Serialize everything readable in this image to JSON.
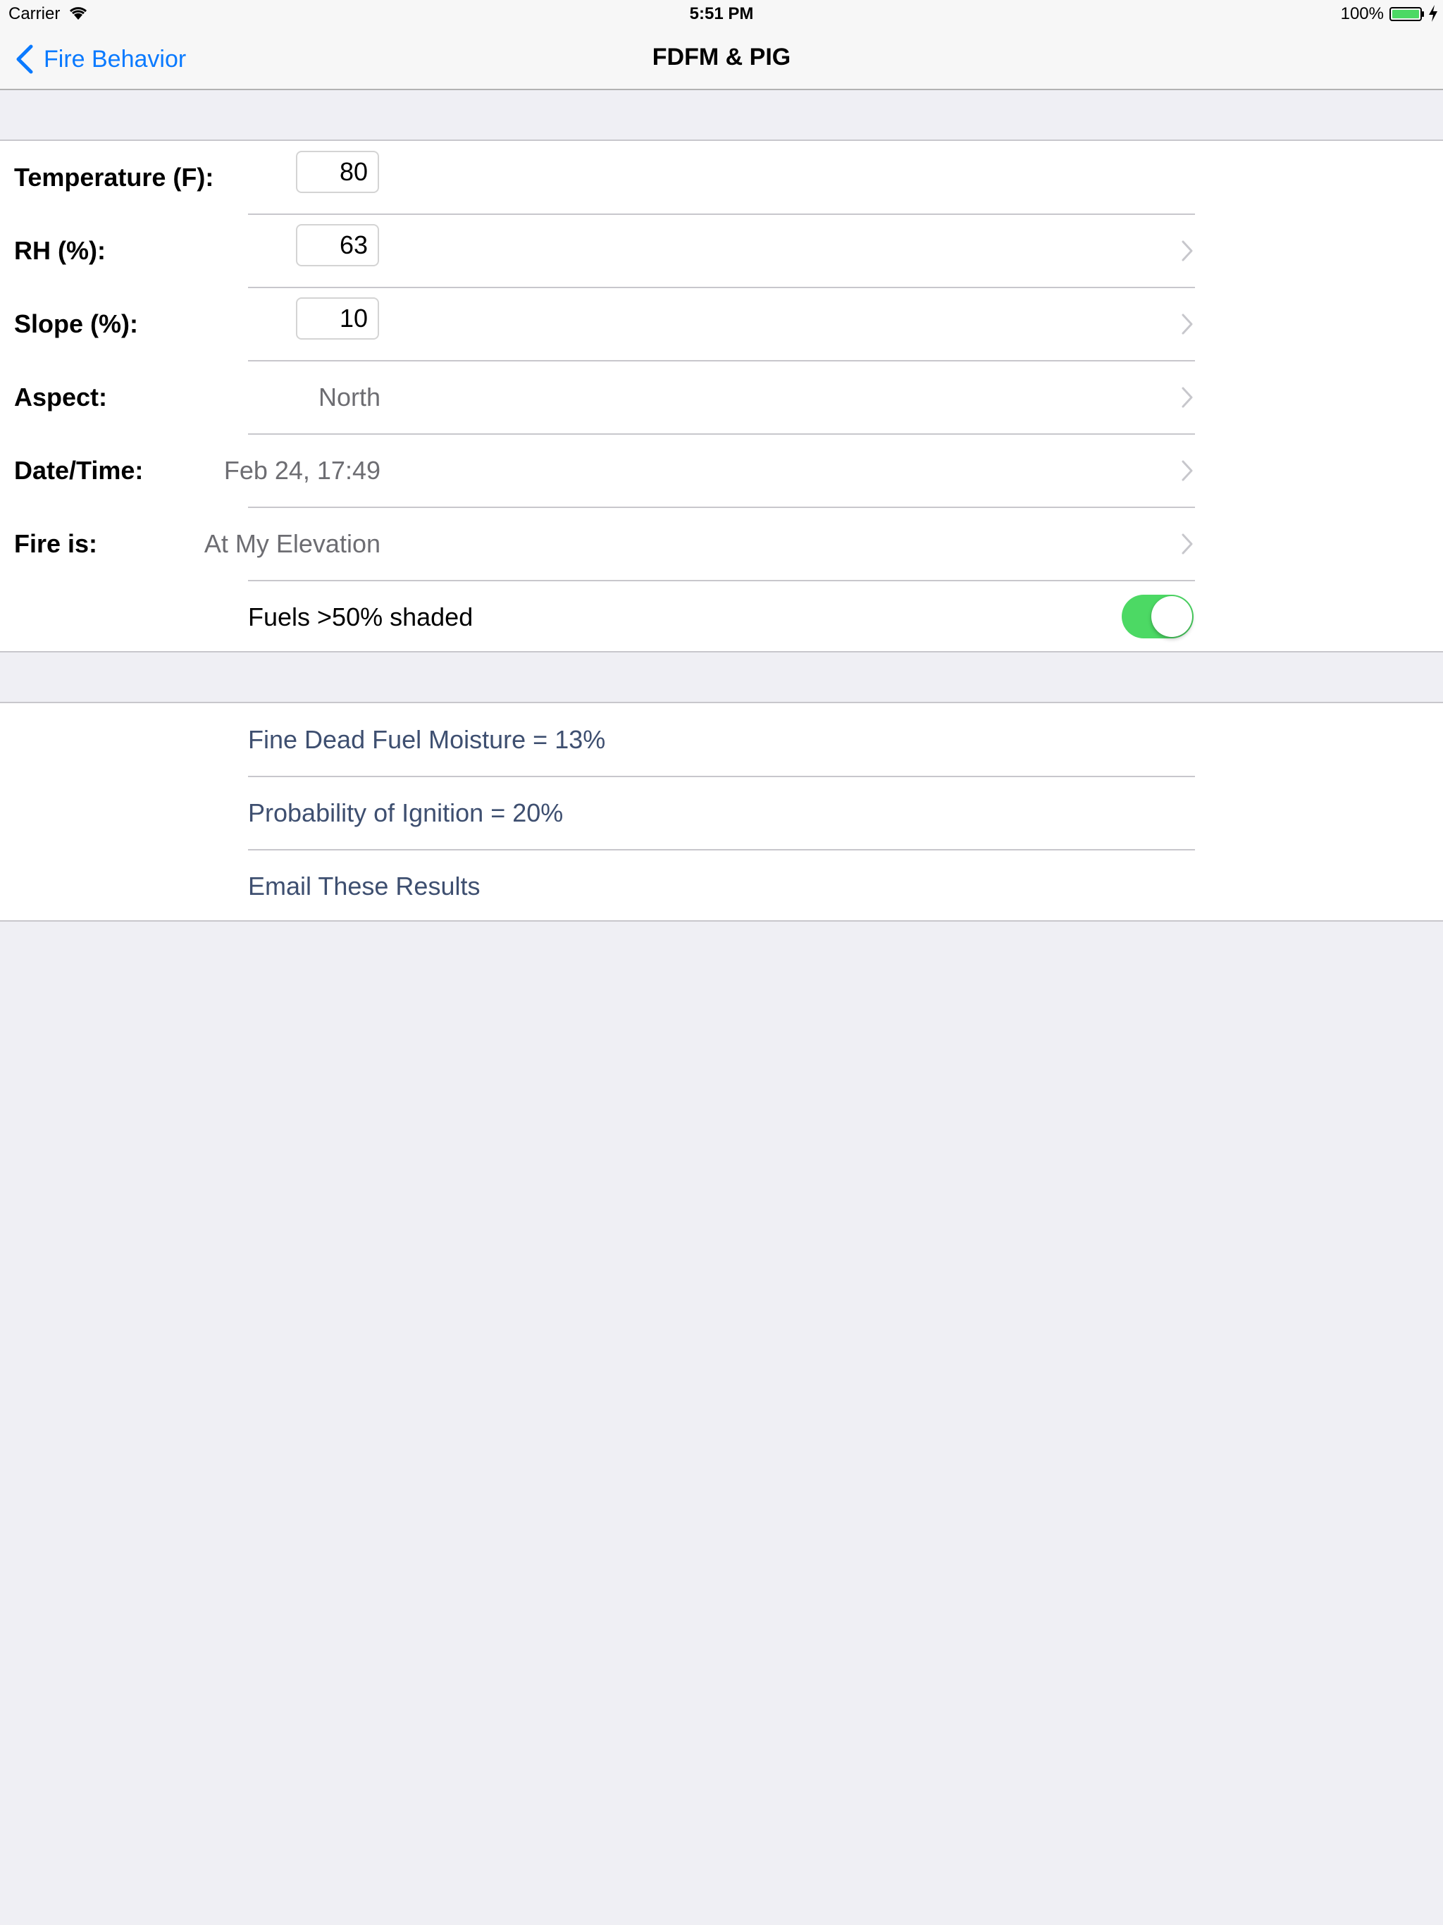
{
  "status_bar": {
    "carrier": "Carrier",
    "time": "5:51 PM",
    "battery": "100%"
  },
  "nav": {
    "back_label": "Fire Behavior",
    "title": "FDFM & PIG"
  },
  "inputs": {
    "temperature": {
      "label": "Temperature (F):",
      "value": "80"
    },
    "rh": {
      "label": "RH (%):",
      "value": "63"
    },
    "slope": {
      "label": "Slope (%):",
      "value": "10"
    },
    "aspect": {
      "label": "Aspect:",
      "value": "North"
    },
    "datetime": {
      "label": "Date/Time:",
      "value": "Feb 24, 17:49"
    },
    "fire_is": {
      "label": "Fire is:",
      "value": "At My Elevation"
    },
    "shaded": {
      "label": "Fuels >50% shaded",
      "on": true
    }
  },
  "results": {
    "fdfm": "Fine Dead Fuel Moisture = 13%",
    "pig": "Probability of Ignition = 20%",
    "email": "Email These Results"
  },
  "colors": {
    "tint": "#0a7aff",
    "toggle_on": "#4cd964",
    "result_text": "#3e4f70",
    "background": "#efeff4"
  }
}
